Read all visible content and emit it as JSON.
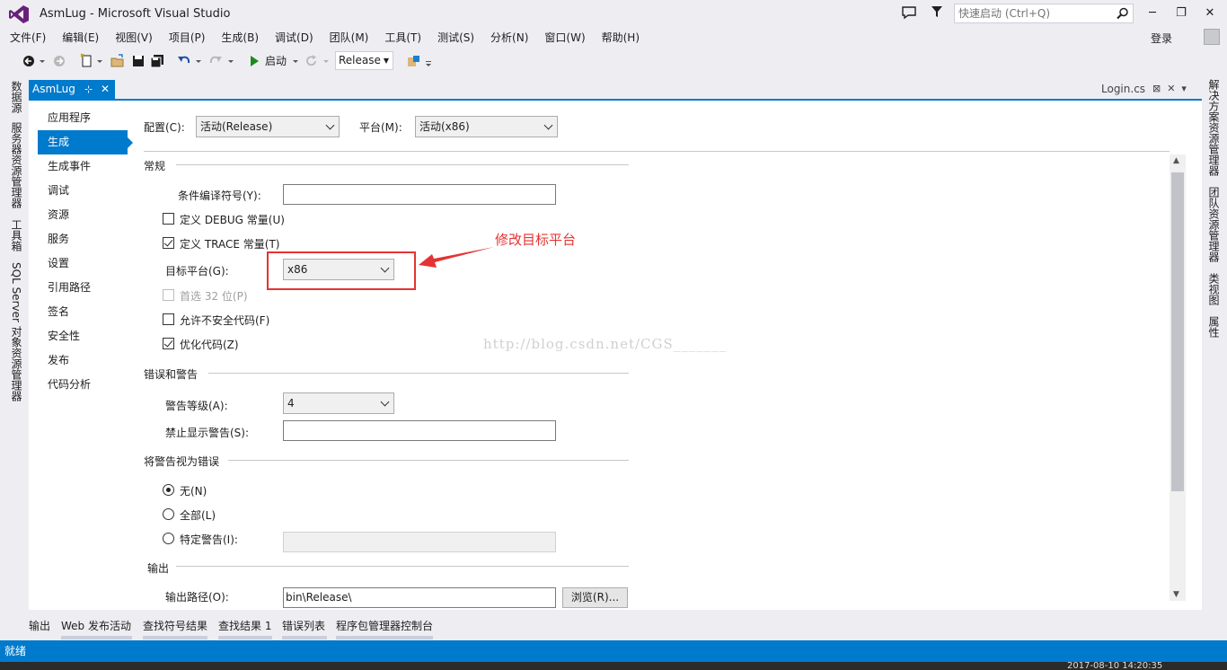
{
  "window": {
    "title": "AsmLug - Microsoft Visual Studio",
    "quick_launch_placeholder": "快速启动 (Ctrl+Q)",
    "login": "登录",
    "minimize": "─",
    "restore": "❐",
    "close": "✕"
  },
  "menu": [
    "文件(F)",
    "编辑(E)",
    "视图(V)",
    "项目(P)",
    "生成(B)",
    "调试(D)",
    "团队(M)",
    "工具(T)",
    "测试(S)",
    "分析(N)",
    "窗口(W)",
    "帮助(H)"
  ],
  "toolbar": {
    "start_label": "启动",
    "configuration": "Release"
  },
  "left_tabs": [
    "数据源",
    "服务器资源管理器",
    "工具箱",
    "SQL Server 对象资源管理器"
  ],
  "right_tabs": [
    "解决方案资源管理器",
    "团队资源管理器",
    "类视图",
    "属性"
  ],
  "doc_tab": {
    "title": "AsmLug",
    "pin": "⊹",
    "close": "✕",
    "other_tab": "Login.cs",
    "other_icons": "⊠✕▾"
  },
  "nav": [
    "应用程序",
    "生成",
    "生成事件",
    "调试",
    "资源",
    "服务",
    "设置",
    "引用路径",
    "签名",
    "安全性",
    "发布",
    "代码分析"
  ],
  "nav_active_index": 1,
  "config_row": {
    "config_label": "配置(C):",
    "config_value": "活动(Release)",
    "platform_label": "平台(M):",
    "platform_value": "活动(x86)"
  },
  "general": {
    "section": "常规",
    "conditional_symbols_label": "条件编译符号(Y):",
    "conditional_symbols_value": "",
    "define_debug": "定义 DEBUG 常量(U)",
    "define_debug_checked": false,
    "define_trace": "定义 TRACE 常量(T)",
    "define_trace_checked": true,
    "target_platform_label": "目标平台(G):",
    "target_platform_value": "x86",
    "prefer32": "首选 32 位(P)",
    "prefer32_checked": false,
    "allow_unsafe": "允许不安全代码(F)",
    "allow_unsafe_checked": false,
    "optimize": "优化代码(Z)",
    "optimize_checked": true
  },
  "errors": {
    "section": "错误和警告",
    "warning_level_label": "警告等级(A):",
    "warning_level_value": "4",
    "suppress_label": "禁止显示警告(S):",
    "suppress_value": ""
  },
  "treat_as_errors": {
    "section": "将警告视为错误",
    "none": "无(N)",
    "all": "全部(L)",
    "specific": "特定警告(I):",
    "selected": "none"
  },
  "output": {
    "section": "输出",
    "path_label": "输出路径(O):",
    "path_value": "bin\\Release\\",
    "browse": "浏览(R)..."
  },
  "annotation": {
    "text": "修改目标平台",
    "color": "#e53333"
  },
  "watermark": "http://blog.csdn.net/CGS_______",
  "bottom_tabs": [
    "输出",
    "Web 发布活动",
    "查找符号结果",
    "查找结果 1",
    "错误列表",
    "程序包管理器控制台"
  ],
  "status": "就绪",
  "clock": "2017-08-10  14:20:35",
  "colors": {
    "accent": "#007acc",
    "vs_purple": "#68217a"
  }
}
